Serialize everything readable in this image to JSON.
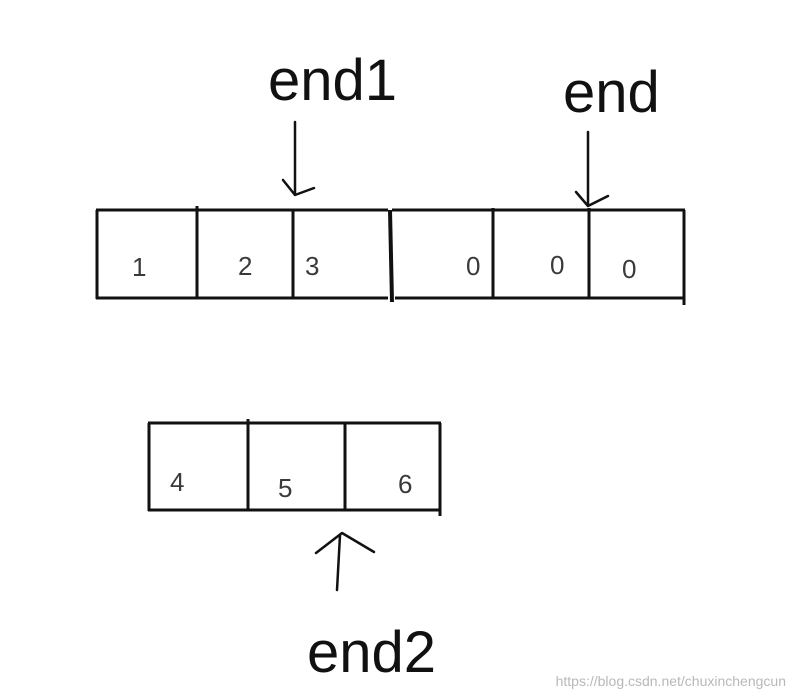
{
  "labels": {
    "end1": "end1",
    "end": "end",
    "end2": "end2"
  },
  "array_a": {
    "cells": [
      "1",
      "2",
      "3",
      "0",
      "0",
      "0"
    ]
  },
  "array_b": {
    "cells": [
      "4",
      "5",
      "6"
    ]
  },
  "watermark": "https://blog.csdn.net/chuxinchengcun"
}
